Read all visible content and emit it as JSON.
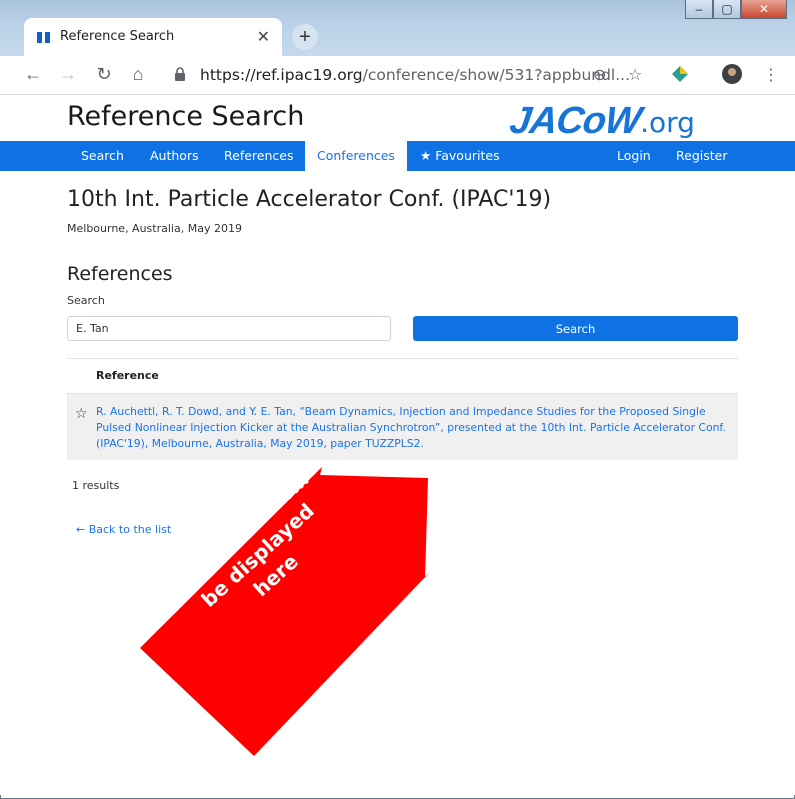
{
  "browser": {
    "tab_title": "Reference Search",
    "url_host": "https://ref.ipac19.org",
    "url_path": "/conference/show/531?appbundl..."
  },
  "header": {
    "site_title": "Reference Search",
    "logo_main": "JACoW",
    "logo_suffix": ".org"
  },
  "nav": {
    "search": "Search",
    "authors": "Authors",
    "references": "References",
    "conferences": "Conferences",
    "favourites": "Favourites",
    "login": "Login",
    "register": "Register"
  },
  "conference": {
    "title": "10th Int. Particle Accelerator Conf. (IPAC'19)",
    "subtitle": "Melbourne, Australia, May 2019"
  },
  "references": {
    "heading": "References",
    "search_label": "Search",
    "search_value": "E. Tan",
    "search_button": "Search",
    "column_header": "Reference",
    "results": [
      {
        "text": "R. Auchettl, R. T. Dowd, and Y. E. Tan, “Beam Dynamics, Injection and Impedance Studies for the Proposed Single Pulsed Nonlinear Injection Kicker at the Australian Synchrotron”, presented at the 10th Int. Particle Accelerator Conf. (IPAC'19), Melbourne, Australia, May 2019, paper TUZZPLS2."
      }
    ],
    "results_count": "1 results",
    "back_link": "Back to the list"
  },
  "annotation": {
    "line1": "All matches will",
    "line2": "be displayed",
    "line3": "here"
  },
  "colors": {
    "accent": "#0e72e5",
    "link": "#1a73e8",
    "annotation": "#ff0000"
  }
}
